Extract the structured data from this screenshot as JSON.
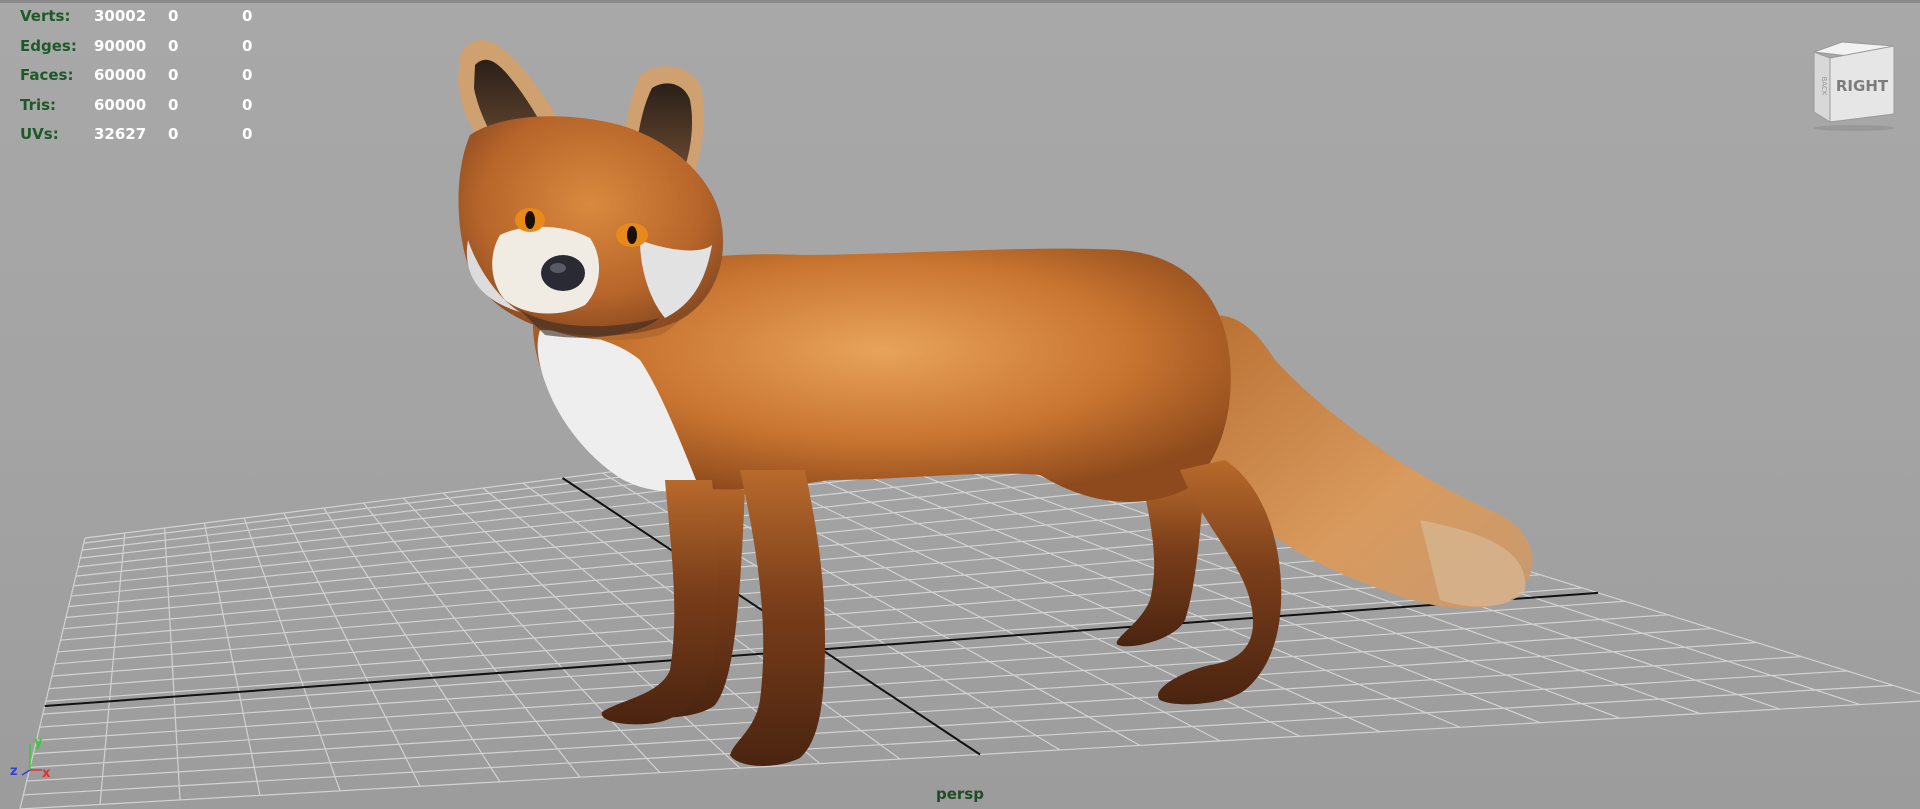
{
  "hud": {
    "rows": [
      {
        "label": "Verts:",
        "v1": "30002",
        "v2": "0",
        "v3": "0"
      },
      {
        "label": "Edges:",
        "v1": "90000",
        "v2": "0",
        "v3": "0"
      },
      {
        "label": "Faces:",
        "v1": "60000",
        "v2": "0",
        "v3": "0"
      },
      {
        "label": "Tris:",
        "v1": "60000",
        "v2": "0",
        "v3": "0"
      },
      {
        "label": "UVs:",
        "v1": "32627",
        "v2": "0",
        "v3": "0"
      }
    ]
  },
  "viewcube": {
    "face_label": "RIGHT",
    "side_label": "BACK"
  },
  "camera": {
    "name": "persp"
  },
  "axis": {
    "y": "y",
    "z": "z",
    "x": "x"
  },
  "colors": {
    "viewport_bg": "#a4a4a4",
    "grid_line": "#d2d2d2",
    "grid_axis": "#111111",
    "hud_label": "#1e5a28",
    "hud_value": "#ffffff",
    "axis_x": "#e03030",
    "axis_y": "#30d030",
    "axis_z": "#3040e0"
  }
}
